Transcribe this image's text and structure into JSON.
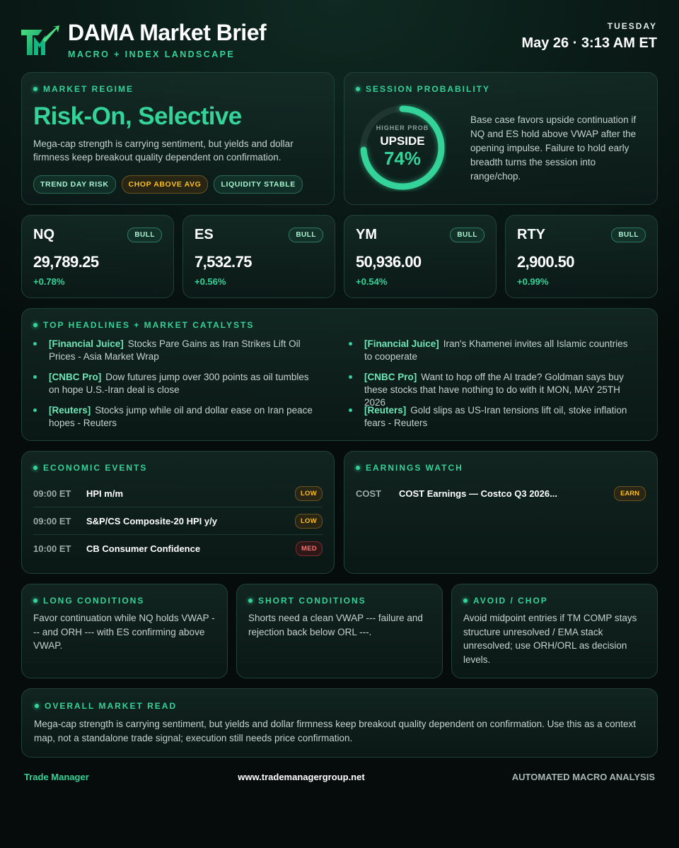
{
  "header": {
    "title": "DAMA Market Brief",
    "subtitle": "MACRO + INDEX LANDSCAPE",
    "day": "TUESDAY",
    "datetime": "May 26 · 3:13 AM ET",
    "logo_icon": "tm-logo-icon"
  },
  "regime": {
    "label": "MARKET REGIME",
    "title": "Risk-On, Selective",
    "description": "Mega-cap strength is carrying sentiment, but yields and dollar firmness keep breakout quality dependent on confirmation.",
    "chips": [
      "TREND DAY RISK",
      "CHOP ABOVE AVG",
      "LIQUIDITY STABLE"
    ]
  },
  "probability": {
    "label": "SESSION PROBABILITY",
    "gauge_label": "HIGHER PROB",
    "direction": "UPSIDE",
    "percent_text": "74%",
    "percent": 74,
    "description": "Base case favors upside continuation if NQ and ES hold above VWAP after the opening impulse. Failure to hold early breadth turns the session into range/chop."
  },
  "indices": [
    {
      "name": "NQ",
      "badge": "BULL",
      "price": "29,789.25",
      "change": "+0.78%"
    },
    {
      "name": "ES",
      "badge": "BULL",
      "price": "7,532.75",
      "change": "+0.56%"
    },
    {
      "name": "YM",
      "badge": "BULL",
      "price": "50,936.00",
      "change": "+0.54%"
    },
    {
      "name": "RTY",
      "badge": "BULL",
      "price": "2,900.50",
      "change": "+0.99%"
    }
  ],
  "headlines": {
    "label": "TOP HEADLINES + MARKET CATALYSTS",
    "items": [
      {
        "source": "[Financial Juice]",
        "text": "Stocks Pare Gains as Iran Strikes Lift Oil Prices - Asia Market Wrap"
      },
      {
        "source": "[Financial Juice]",
        "text": "Iran's Khamenei invites all Islamic countries to cooperate"
      },
      {
        "source": "[CNBC Pro]",
        "text": "Dow futures jump over 300 points as oil tumbles on hope U.S.-Iran deal is close"
      },
      {
        "source": "[CNBC Pro]",
        "text": "Want to hop off the AI trade? Goldman says buy these stocks that have nothing to do with it MON, MAY 25TH 2026"
      },
      {
        "source": "[Reuters]",
        "text": "Stocks jump while oil and dollar ease on Iran peace hopes - Reuters"
      },
      {
        "source": "[Reuters]",
        "text": "Gold slips as US-Iran tensions lift oil, stoke inflation fears - Reuters"
      }
    ]
  },
  "events": {
    "label": "ECONOMIC EVENTS",
    "rows": [
      {
        "time": "09:00 ET",
        "name": "HPI m/m",
        "level": "LOW"
      },
      {
        "time": "09:00 ET",
        "name": "S&P/CS Composite-20 HPI y/y",
        "level": "LOW"
      },
      {
        "time": "10:00 ET",
        "name": "CB Consumer Confidence",
        "level": "MED"
      }
    ]
  },
  "earnings": {
    "label": "EARNINGS WATCH",
    "rows": [
      {
        "ticker": "COST",
        "name": "COST Earnings — Costco Q3 2026...",
        "badge": "EARN"
      }
    ]
  },
  "conditions": {
    "long": {
      "label": "LONG CONDITIONS",
      "text": "Favor continuation while NQ holds VWAP --- and ORH --- with ES confirming above VWAP."
    },
    "short": {
      "label": "SHORT CONDITIONS",
      "text": "Shorts need a clean VWAP --- failure and rejection back below ORL ---."
    },
    "avoid": {
      "label": "AVOID / CHOP",
      "text": "Avoid midpoint entries if TM COMP stays structure unresolved / EMA stack unresolved; use ORH/ORL as decision levels."
    }
  },
  "overall": {
    "label": "OVERALL MARKET READ",
    "text": "Mega-cap strength is carrying sentiment, but yields and dollar firmness keep breakout quality dependent on confirmation. Use this as a context map, not a standalone trade signal; execution still needs price confirmation."
  },
  "footer": {
    "left": "Trade Manager",
    "center": "www.trademanagergroup.net",
    "right": "AUTOMATED MACRO ANALYSIS"
  },
  "colors": {
    "accent": "#34d399",
    "warn": "#fbbf24",
    "danger": "#f87171",
    "background": "#0a1a16"
  }
}
